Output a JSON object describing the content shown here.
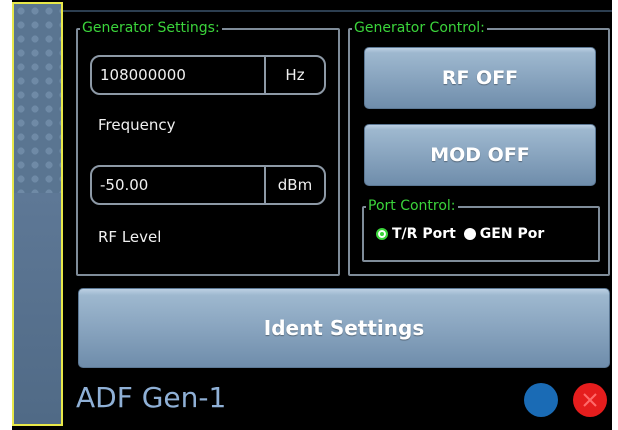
{
  "generator_settings": {
    "title": "Generator Settings:",
    "frequency": {
      "value": "108000000",
      "unit": "Hz",
      "label": "Frequency"
    },
    "rf_level": {
      "value": "-50.00",
      "unit": "dBm",
      "label": "RF Level"
    }
  },
  "generator_control": {
    "title": "Generator Control:",
    "rf_button": "RF OFF",
    "mod_button": "MOD OFF"
  },
  "port_control": {
    "title": "Port Control:",
    "options": [
      "T/R Port",
      "GEN Por"
    ],
    "selected": "T/R Port"
  },
  "ident_button": "Ident Settings",
  "panel_title": "ADF Gen-1",
  "icons": {
    "blue_button": "circle-icon",
    "close_button": "close-icon"
  },
  "colors": {
    "accent_green": "#3bd43b",
    "button_blue": "#86a2bd",
    "title_blue": "#8fb0d6",
    "close_red": "#e51d1d",
    "circle_blue": "#1a6bb5"
  }
}
